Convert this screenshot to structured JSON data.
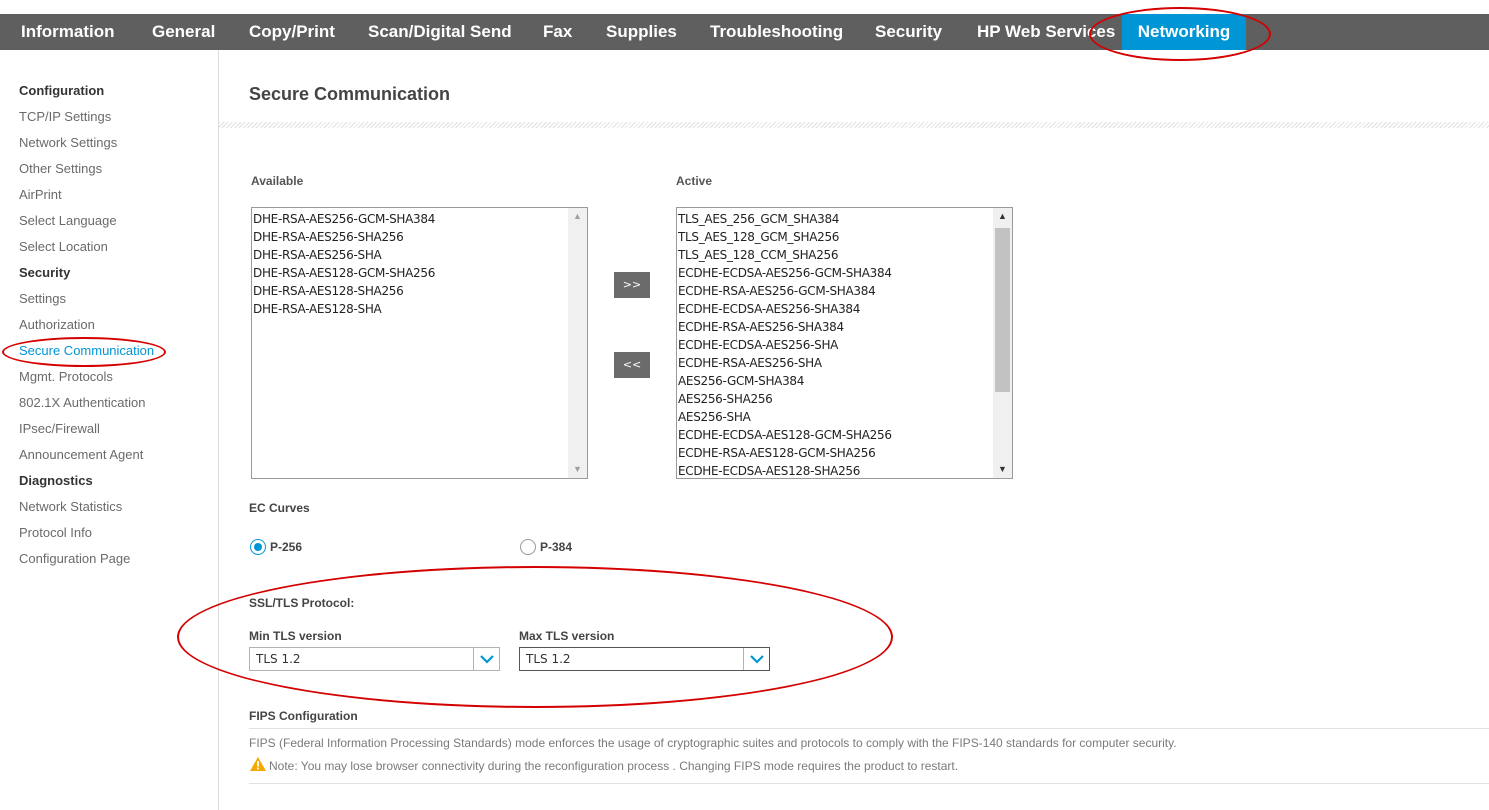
{
  "nav": {
    "tabs": [
      "Information",
      "General",
      "Copy/Print",
      "Scan/Digital Send",
      "Fax",
      "Supplies",
      "Troubleshooting",
      "Security",
      "HP Web Services",
      "Networking"
    ],
    "active": "Networking"
  },
  "sidebar": {
    "configuration_heading": "Configuration",
    "configuration_items": [
      "TCP/IP Settings",
      "Network Settings",
      "Other Settings",
      "AirPrint",
      "Select Language",
      "Select Location"
    ],
    "security_heading": "Security",
    "security_items": [
      "Settings",
      "Authorization",
      "Secure Communication",
      "Mgmt. Protocols",
      "802.1X Authentication",
      "IPsec/Firewall",
      "Announcement Agent"
    ],
    "diagnostics_heading": "Diagnostics",
    "diagnostics_items": [
      "Network Statistics",
      "Protocol Info",
      "Configuration Page"
    ],
    "current": "Secure Communication"
  },
  "page": {
    "title": "Secure Communication"
  },
  "ciphers": {
    "available_label": "Available",
    "active_label": "Active",
    "available": [
      "DHE-RSA-AES256-GCM-SHA384",
      "DHE-RSA-AES256-SHA256",
      "DHE-RSA-AES256-SHA",
      "DHE-RSA-AES128-GCM-SHA256",
      "DHE-RSA-AES128-SHA256",
      "DHE-RSA-AES128-SHA"
    ],
    "active": [
      "TLS_AES_256_GCM_SHA384",
      "TLS_AES_128_GCM_SHA256",
      "TLS_AES_128_CCM_SHA256",
      "ECDHE-ECDSA-AES256-GCM-SHA384",
      "ECDHE-RSA-AES256-GCM-SHA384",
      "ECDHE-ECDSA-AES256-SHA384",
      "ECDHE-RSA-AES256-SHA384",
      "ECDHE-ECDSA-AES256-SHA",
      "ECDHE-RSA-AES256-SHA",
      "AES256-GCM-SHA384",
      "AES256-SHA256",
      "AES256-SHA",
      "ECDHE-ECDSA-AES128-GCM-SHA256",
      "ECDHE-RSA-AES128-GCM-SHA256",
      "ECDHE-ECDSA-AES128-SHA256"
    ],
    "add_button": ">>",
    "remove_button": "<<"
  },
  "ec_curves": {
    "label": "EC Curves",
    "options": [
      "P-256",
      "P-384"
    ],
    "selected": "P-256"
  },
  "tls": {
    "section_label": "SSL/TLS Protocol:",
    "min_label": "Min TLS version",
    "min_value": "TLS 1.2",
    "max_label": "Max TLS version",
    "max_value": "TLS 1.2"
  },
  "fips": {
    "heading": "FIPS Configuration",
    "description": "FIPS (Federal Information Processing Standards) mode enforces the usage of cryptographic suites and protocols to comply with the FIPS-140 standards for computer security.",
    "note": "Note: You may lose browser connectivity during the reconfiguration process . Changing FIPS mode requires the product to restart."
  },
  "colors": {
    "nav_bg": "#5f5f5f",
    "accent": "#0096d6",
    "annotation": "#d40000",
    "warning": "#f4a800"
  },
  "icons": {
    "dropdown": "chevron-down-icon",
    "warning": "warning-triangle-icon"
  }
}
